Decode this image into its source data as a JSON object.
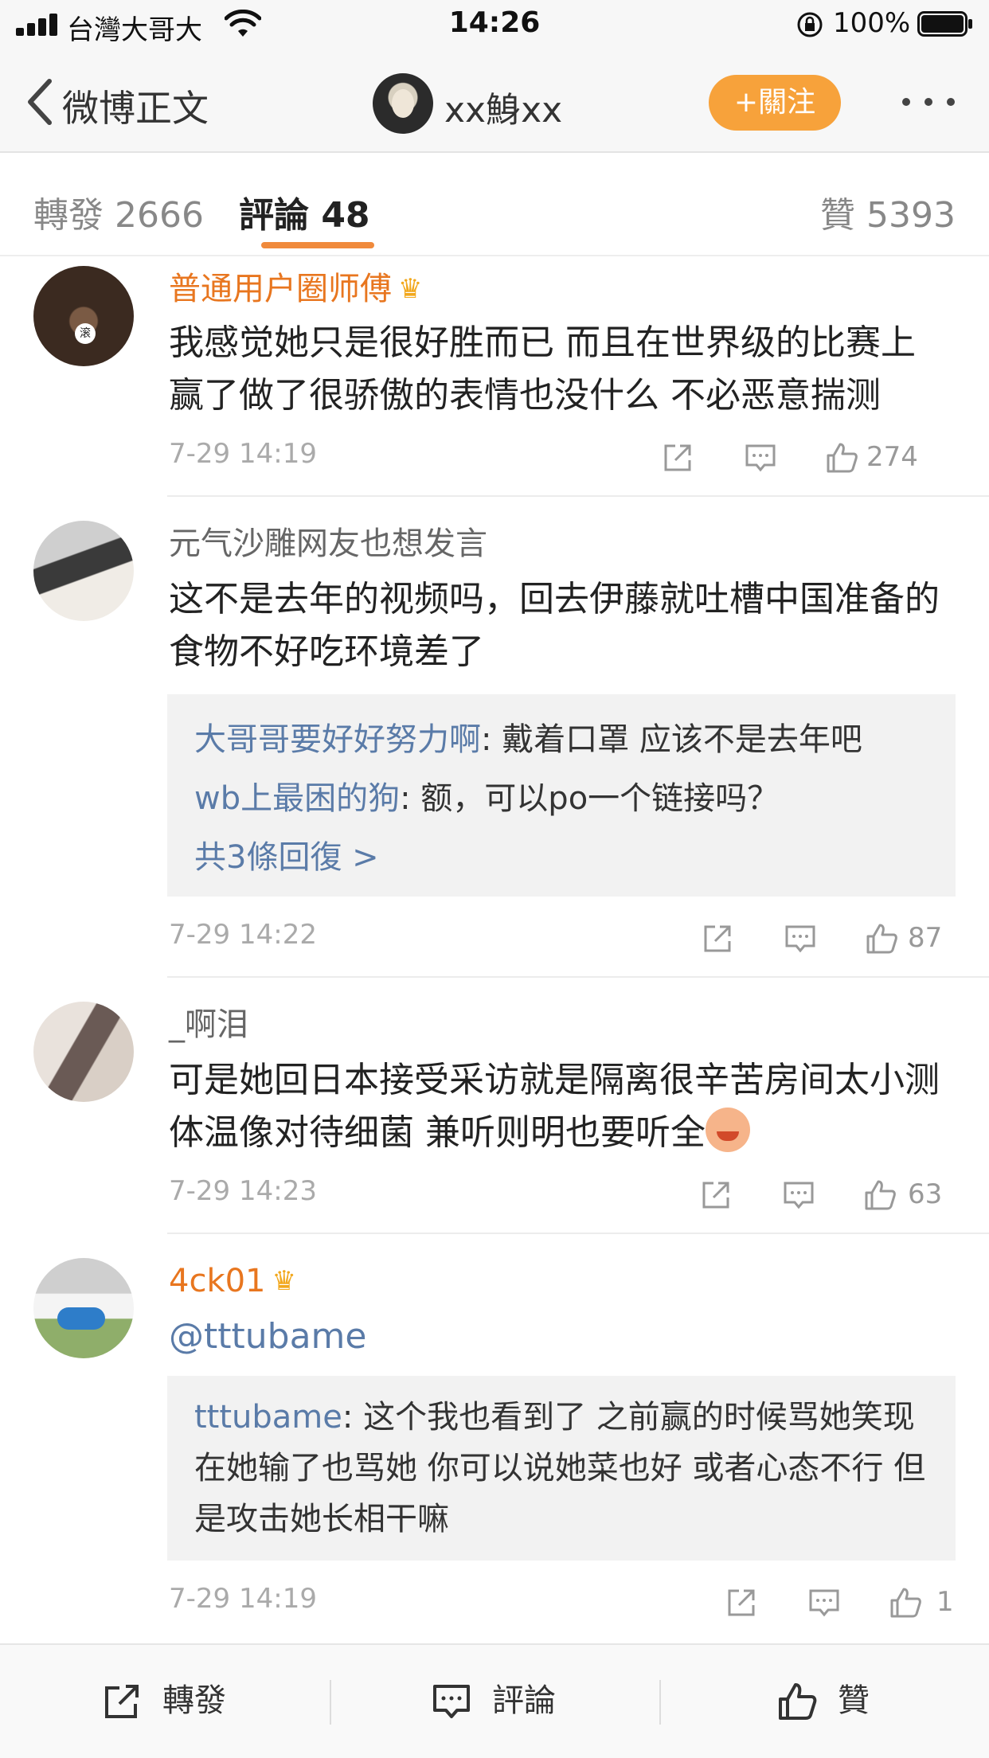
{
  "status_bar": {
    "carrier": "台灣大哥大",
    "time": "14:26",
    "battery": "100%"
  },
  "nav": {
    "back_label": "微博正文",
    "title": "xx鯓xx",
    "follow_label": "+關注"
  },
  "tabs": {
    "repost": "轉發 2666",
    "comments": "評論 48",
    "likes": "贊 5393"
  },
  "comments": [
    {
      "username": "普通用户圈师傅",
      "text": "我感觉她只是很好胜而已 而且在世界级的比赛上赢了做了很骄傲的表情也没什么 不必恶意揣测",
      "time": "7-29 14:19",
      "likes": "274"
    },
    {
      "username": "元气沙雕网友也想发言",
      "text": "这不是去年的视频吗，回去伊藤就吐槽中国准备的食物不好吃环境差了",
      "replies": [
        {
          "name": "大哥哥要好好努力啊",
          "text": ": 戴着口罩 应该不是去年吧"
        },
        {
          "name": "wb上最困的狗",
          "text": ": 额，可以po一个链接吗？"
        }
      ],
      "replies_more": "共3條回復 >",
      "time": "7-29 14:22",
      "likes": "87"
    },
    {
      "username": "_啊泪",
      "text": "可是她回日本接受采访就是隔离很辛苦房间太小测体温像对待细菌 兼听则明也要听全",
      "time": "7-29 14:23",
      "likes": "63"
    },
    {
      "username": "4ck01",
      "text": "@tttubame",
      "replies": [
        {
          "name": "tttubame",
          "text": ": 这个我也看到了 之前赢的时候骂她笑现在她输了也骂她 你可以说她菜也好 或者心态不行 但是攻击她长相干嘛"
        }
      ],
      "time": "7-29 14:19",
      "likes": "1"
    }
  ],
  "bottom_bar": {
    "repost": "轉發",
    "comment": "評論",
    "like": "贊"
  },
  "colors": {
    "accent_orange": "#f7a23b",
    "vip_name": "#e8761f",
    "link_blue": "#5a7ba8"
  }
}
